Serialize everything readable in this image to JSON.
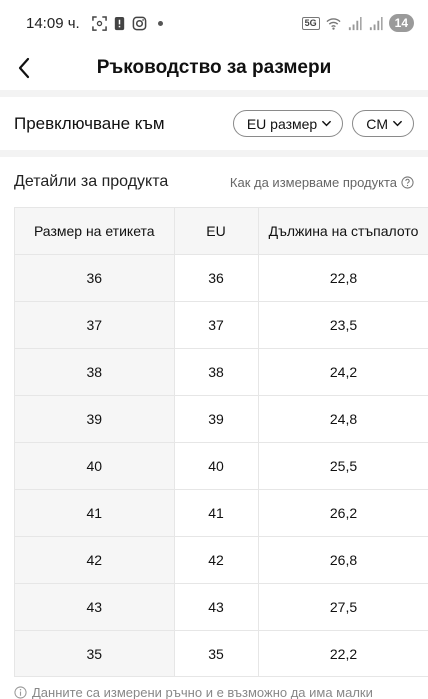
{
  "status_bar": {
    "time": "14:09 ч.",
    "network": "5G",
    "battery": "14",
    "icons": [
      "scan-icon",
      "alert-icon",
      "instagram-icon",
      "notification-dot",
      "wifi-icon",
      "signal-icon",
      "signal-icon"
    ]
  },
  "header": {
    "back_icon": "chevron-left-icon",
    "title": "Ръководство за размери"
  },
  "switch": {
    "label": "Превключване към",
    "size_system": "EU размер",
    "unit": "CM"
  },
  "details": {
    "title": "Детайли за продукта",
    "how_to_measure": "Как да измерваме продукта"
  },
  "table": {
    "headers": [
      "Размер на етикета",
      "EU",
      "Дължина на стъпалото"
    ],
    "rows": [
      [
        "36",
        "36",
        "22,8"
      ],
      [
        "37",
        "37",
        "23,5"
      ],
      [
        "38",
        "38",
        "24,2"
      ],
      [
        "39",
        "39",
        "24,8"
      ],
      [
        "40",
        "40",
        "25,5"
      ],
      [
        "41",
        "41",
        "26,2"
      ],
      [
        "42",
        "42",
        "26,8"
      ],
      [
        "43",
        "43",
        "27,5"
      ],
      [
        "35",
        "35",
        "22,2"
      ]
    ]
  },
  "footnote": "Данните са измерени ръчно и е възможно да има малки"
}
